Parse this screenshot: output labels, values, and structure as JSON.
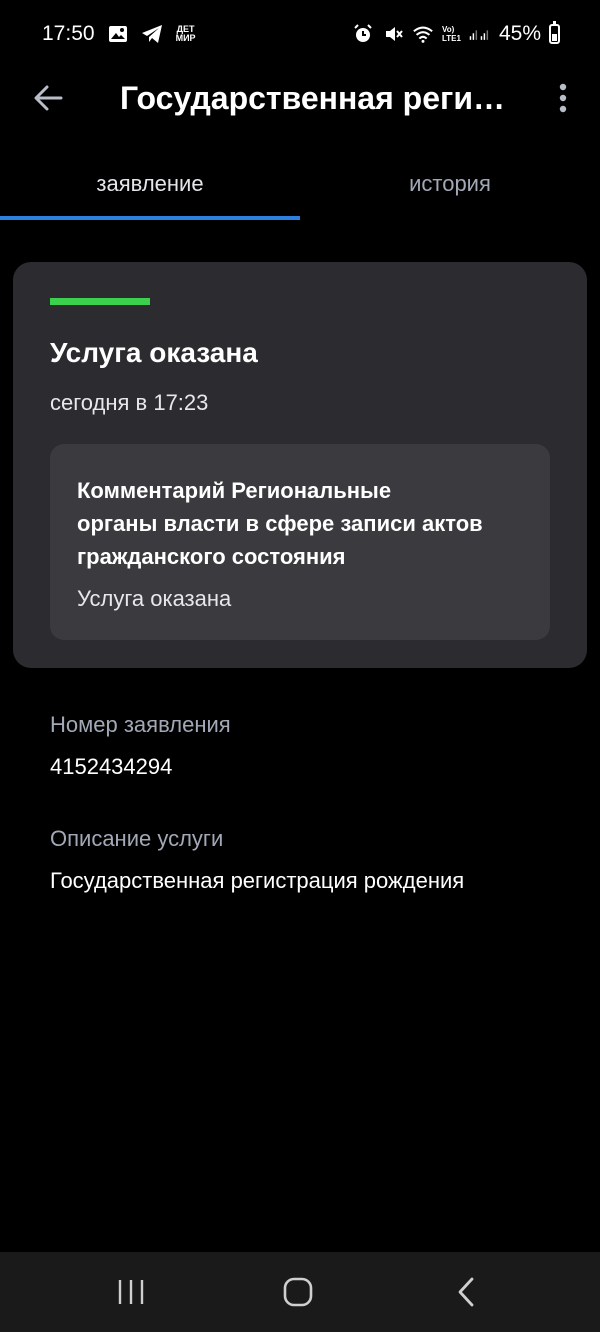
{
  "status_bar": {
    "time": "17:50",
    "det_mir": "ДЕТ\nМИР",
    "network": "Vo)\nLTE1",
    "battery": "45%",
    "icons": [
      "image-icon",
      "telegram-icon",
      "det-mir-icon",
      "alarm-icon",
      "mute-icon",
      "wifi-icon",
      "signal-icon",
      "battery-icon"
    ]
  },
  "app_bar": {
    "title": "Государственная регис…",
    "back_icon": "arrow-left-icon",
    "more_icon": "more-vertical-icon"
  },
  "tabs": [
    {
      "label": "заявление",
      "active": true
    },
    {
      "label": "история",
      "active": false
    }
  ],
  "status_card": {
    "status": "Услуга оказана",
    "date": "сегодня в 17:23",
    "status_color": "#3bd04e",
    "comment": {
      "heading_lines": [
        "Комментарий Региональные",
        "органы власти в сфере записи актов",
        "гражданского состояния"
      ],
      "text": "Услуга оказана"
    }
  },
  "fields": {
    "application_number_label": "Номер заявления",
    "application_number": "4152434294",
    "service_description_label": "Описание услуги",
    "service_description": "Государственная регистрация рождения"
  },
  "colors": {
    "accent": "#2d7fe0",
    "background": "#000000",
    "card": "#2c2c30"
  }
}
